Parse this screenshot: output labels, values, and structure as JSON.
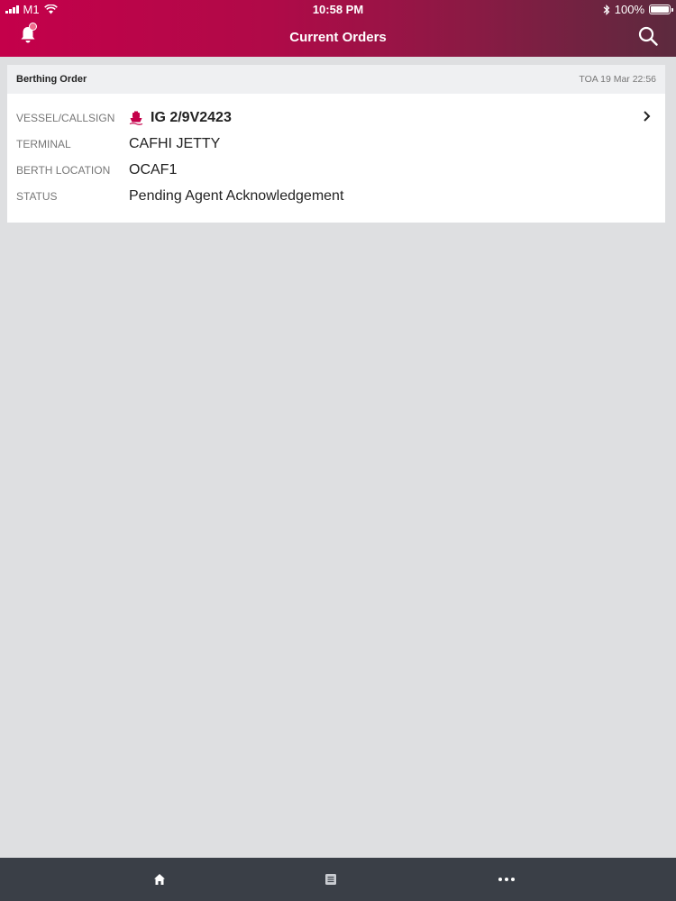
{
  "status_bar": {
    "carrier": "M1",
    "time": "10:58 PM",
    "battery": "100%"
  },
  "header": {
    "title": "Current Orders"
  },
  "card": {
    "title": "Berthing Order",
    "toa": "TOA 19 Mar 22:56",
    "rows": [
      {
        "label": "VESSEL/CALLSIGN",
        "value": "IG 2/9V2423"
      },
      {
        "label": "TERMINAL",
        "value": "CAFHI JETTY"
      },
      {
        "label": "BERTH LOCATION",
        "value": "OCAF1"
      },
      {
        "label": "STATUS",
        "value": "Pending Agent Acknowledgement"
      }
    ]
  },
  "tabbar": {
    "tabs": [
      "home-icon",
      "list-icon",
      "more-icon"
    ]
  },
  "colors": {
    "accent": "#c4004a",
    "tabbar": "#3a3f47",
    "background": "#dedfe1"
  }
}
